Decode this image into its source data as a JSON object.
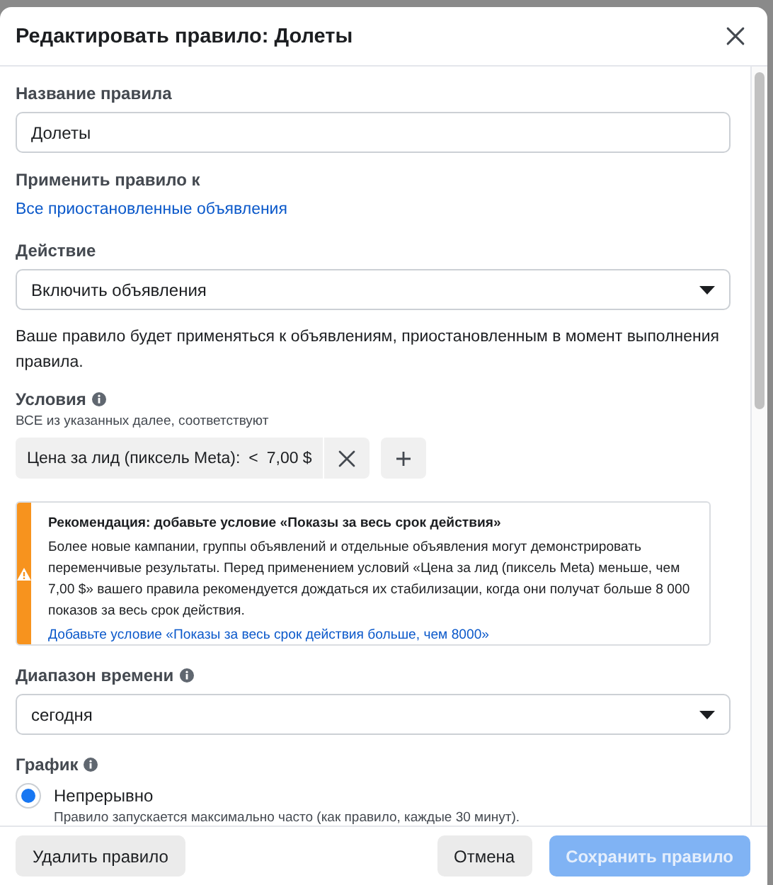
{
  "dialog": {
    "title": "Редактировать правило: Долеты"
  },
  "rule_name": {
    "label": "Название правила",
    "value": "Долеты"
  },
  "apply_to": {
    "label": "Применить правило к",
    "link": "Все приостановленные объявления"
  },
  "action": {
    "label": "Действие",
    "value": "Включить объявления",
    "note": "Ваше правило будет применяться к объявлениям, приостановленным в момент выполнения правила."
  },
  "conditions": {
    "label": "Условия",
    "subtitle": "ВСЕ из указанных далее, соответствуют",
    "items": [
      {
        "metric": "Цена за лид (пиксель Meta):",
        "operator": "<",
        "value": "7,00 $"
      }
    ]
  },
  "recommendation": {
    "title": "Рекомендация: добавьте условие «Показы за весь срок действия»",
    "body": "Более новые кампании, группы объявлений и отдельные объявления могут демонстрировать переменчивые результаты. Перед применением условий «Цена за лид (пиксель Meta) меньше, чем 7,00 $» вашего правила рекомендуется дождаться их стабилизации, когда они получат больше 8 000 показов за весь срок действия.",
    "link": "Добавьте условие «Показы за весь срок действия больше, чем 8000»"
  },
  "time_range": {
    "label": "Диапазон времени",
    "value": "сегодня"
  },
  "schedule": {
    "label": "График",
    "options": [
      {
        "label": "Непрерывно",
        "description": "Правило запускается максимально часто (как правило, каждые 30 минут).",
        "selected": true
      }
    ]
  },
  "footer": {
    "buttons": [
      {
        "label": "Удалить правило",
        "kind": "secondary",
        "disabled": false
      },
      {
        "label": "Отмена",
        "kind": "secondary",
        "disabled": false
      },
      {
        "label": "Сохранить правило",
        "kind": "primary",
        "disabled": true
      }
    ]
  }
}
